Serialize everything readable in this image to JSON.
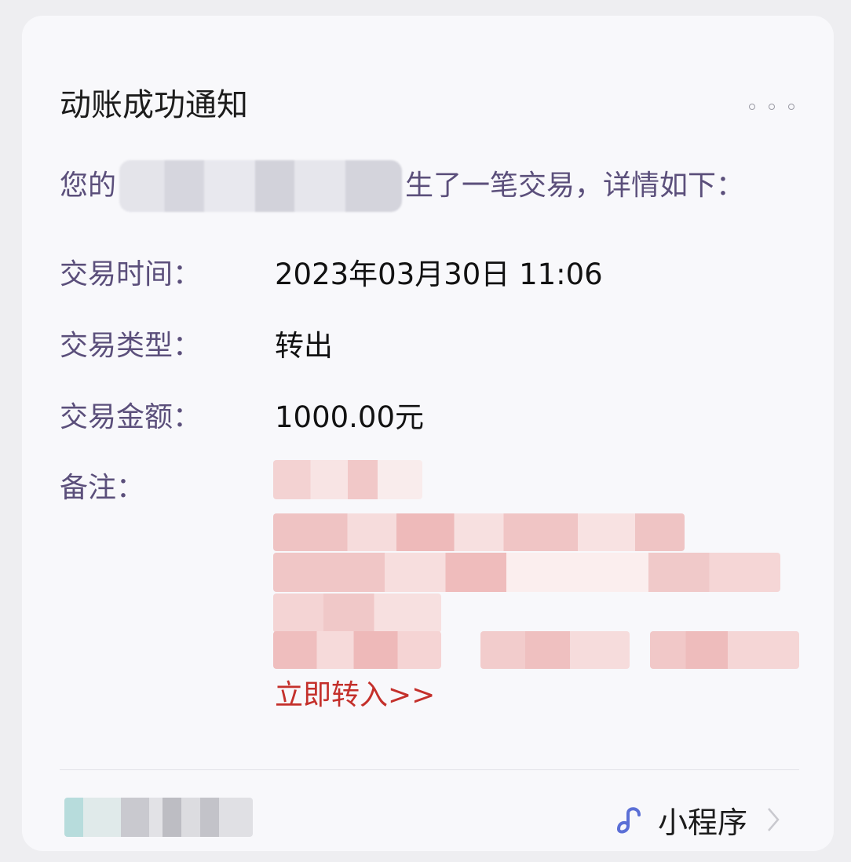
{
  "card": {
    "title": "动账成功通知",
    "intro_prefix": "您的",
    "intro_suffix": "生了一笔交易，详情如下：",
    "rows": [
      {
        "label": "交易时间：",
        "value": "2023年03月30日 11:06"
      },
      {
        "label": "交易类型：",
        "value": "转出"
      },
      {
        "label": "交易金额：",
        "value": "1000.00元"
      },
      {
        "label": "备注：",
        "value": ""
      }
    ],
    "link_text": "立即转入>>",
    "footer": {
      "mini_program_label": "小程序"
    }
  },
  "colors": {
    "label": "#5b4f7b",
    "value": "#121212",
    "link": "#c4302b",
    "mini_icon": "#5b6fd6"
  },
  "icons": [
    "more-icon",
    "mini-program-icon",
    "chevron-right-icon"
  ]
}
